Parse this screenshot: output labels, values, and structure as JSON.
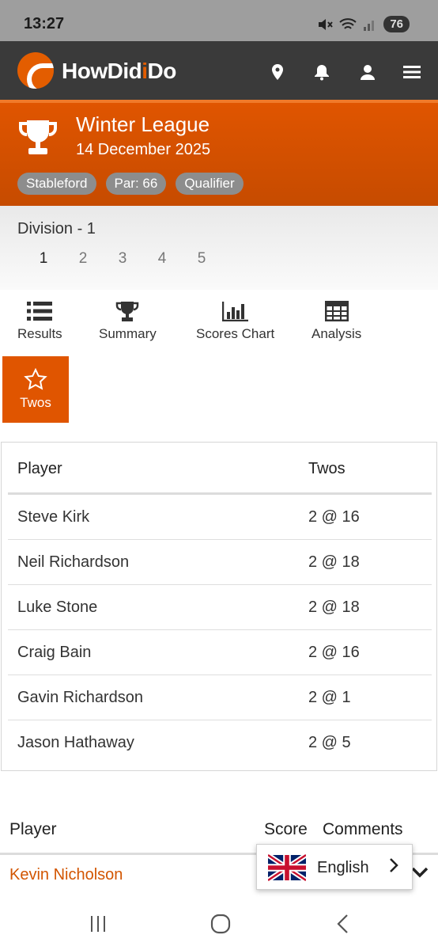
{
  "status": {
    "time": "13:27",
    "battery": "76"
  },
  "header": {
    "logo_part1": "HowDid",
    "logo_part2": "i",
    "logo_part3": "Do"
  },
  "competition": {
    "title": "Winter League",
    "date": "14 December 2025",
    "badges": [
      "Stableford",
      "Par: 66",
      "Qualifier"
    ]
  },
  "division": {
    "label": "Division - 1",
    "pages": [
      "1",
      "2",
      "3",
      "4",
      "5"
    ]
  },
  "tabs": {
    "results": "Results",
    "summary": "Summary",
    "scores_chart": "Scores Chart",
    "analysis": "Analysis",
    "twos": "Twos"
  },
  "twos_table": {
    "headers": {
      "player": "Player",
      "twos": "Twos"
    },
    "rows": [
      {
        "player": "Steve Kirk",
        "twos": "2 @ 16"
      },
      {
        "player": "Neil Richardson",
        "twos": "2 @ 18"
      },
      {
        "player": "Luke Stone",
        "twos": "2 @ 18"
      },
      {
        "player": "Craig Bain",
        "twos": "2 @ 16"
      },
      {
        "player": "Gavin Richardson",
        "twos": "2 @ 1"
      },
      {
        "player": "Jason Hathaway",
        "twos": "2 @ 5"
      }
    ]
  },
  "results_table": {
    "headers": {
      "player": "Player",
      "score": "Score",
      "comments": "Comments"
    },
    "first_row_player": "Kevin Nicholson"
  },
  "language": {
    "label": "English"
  },
  "colors": {
    "accent": "#e05500",
    "header_bg": "#3a3a3a",
    "status_bg": "#9e9e9e"
  }
}
